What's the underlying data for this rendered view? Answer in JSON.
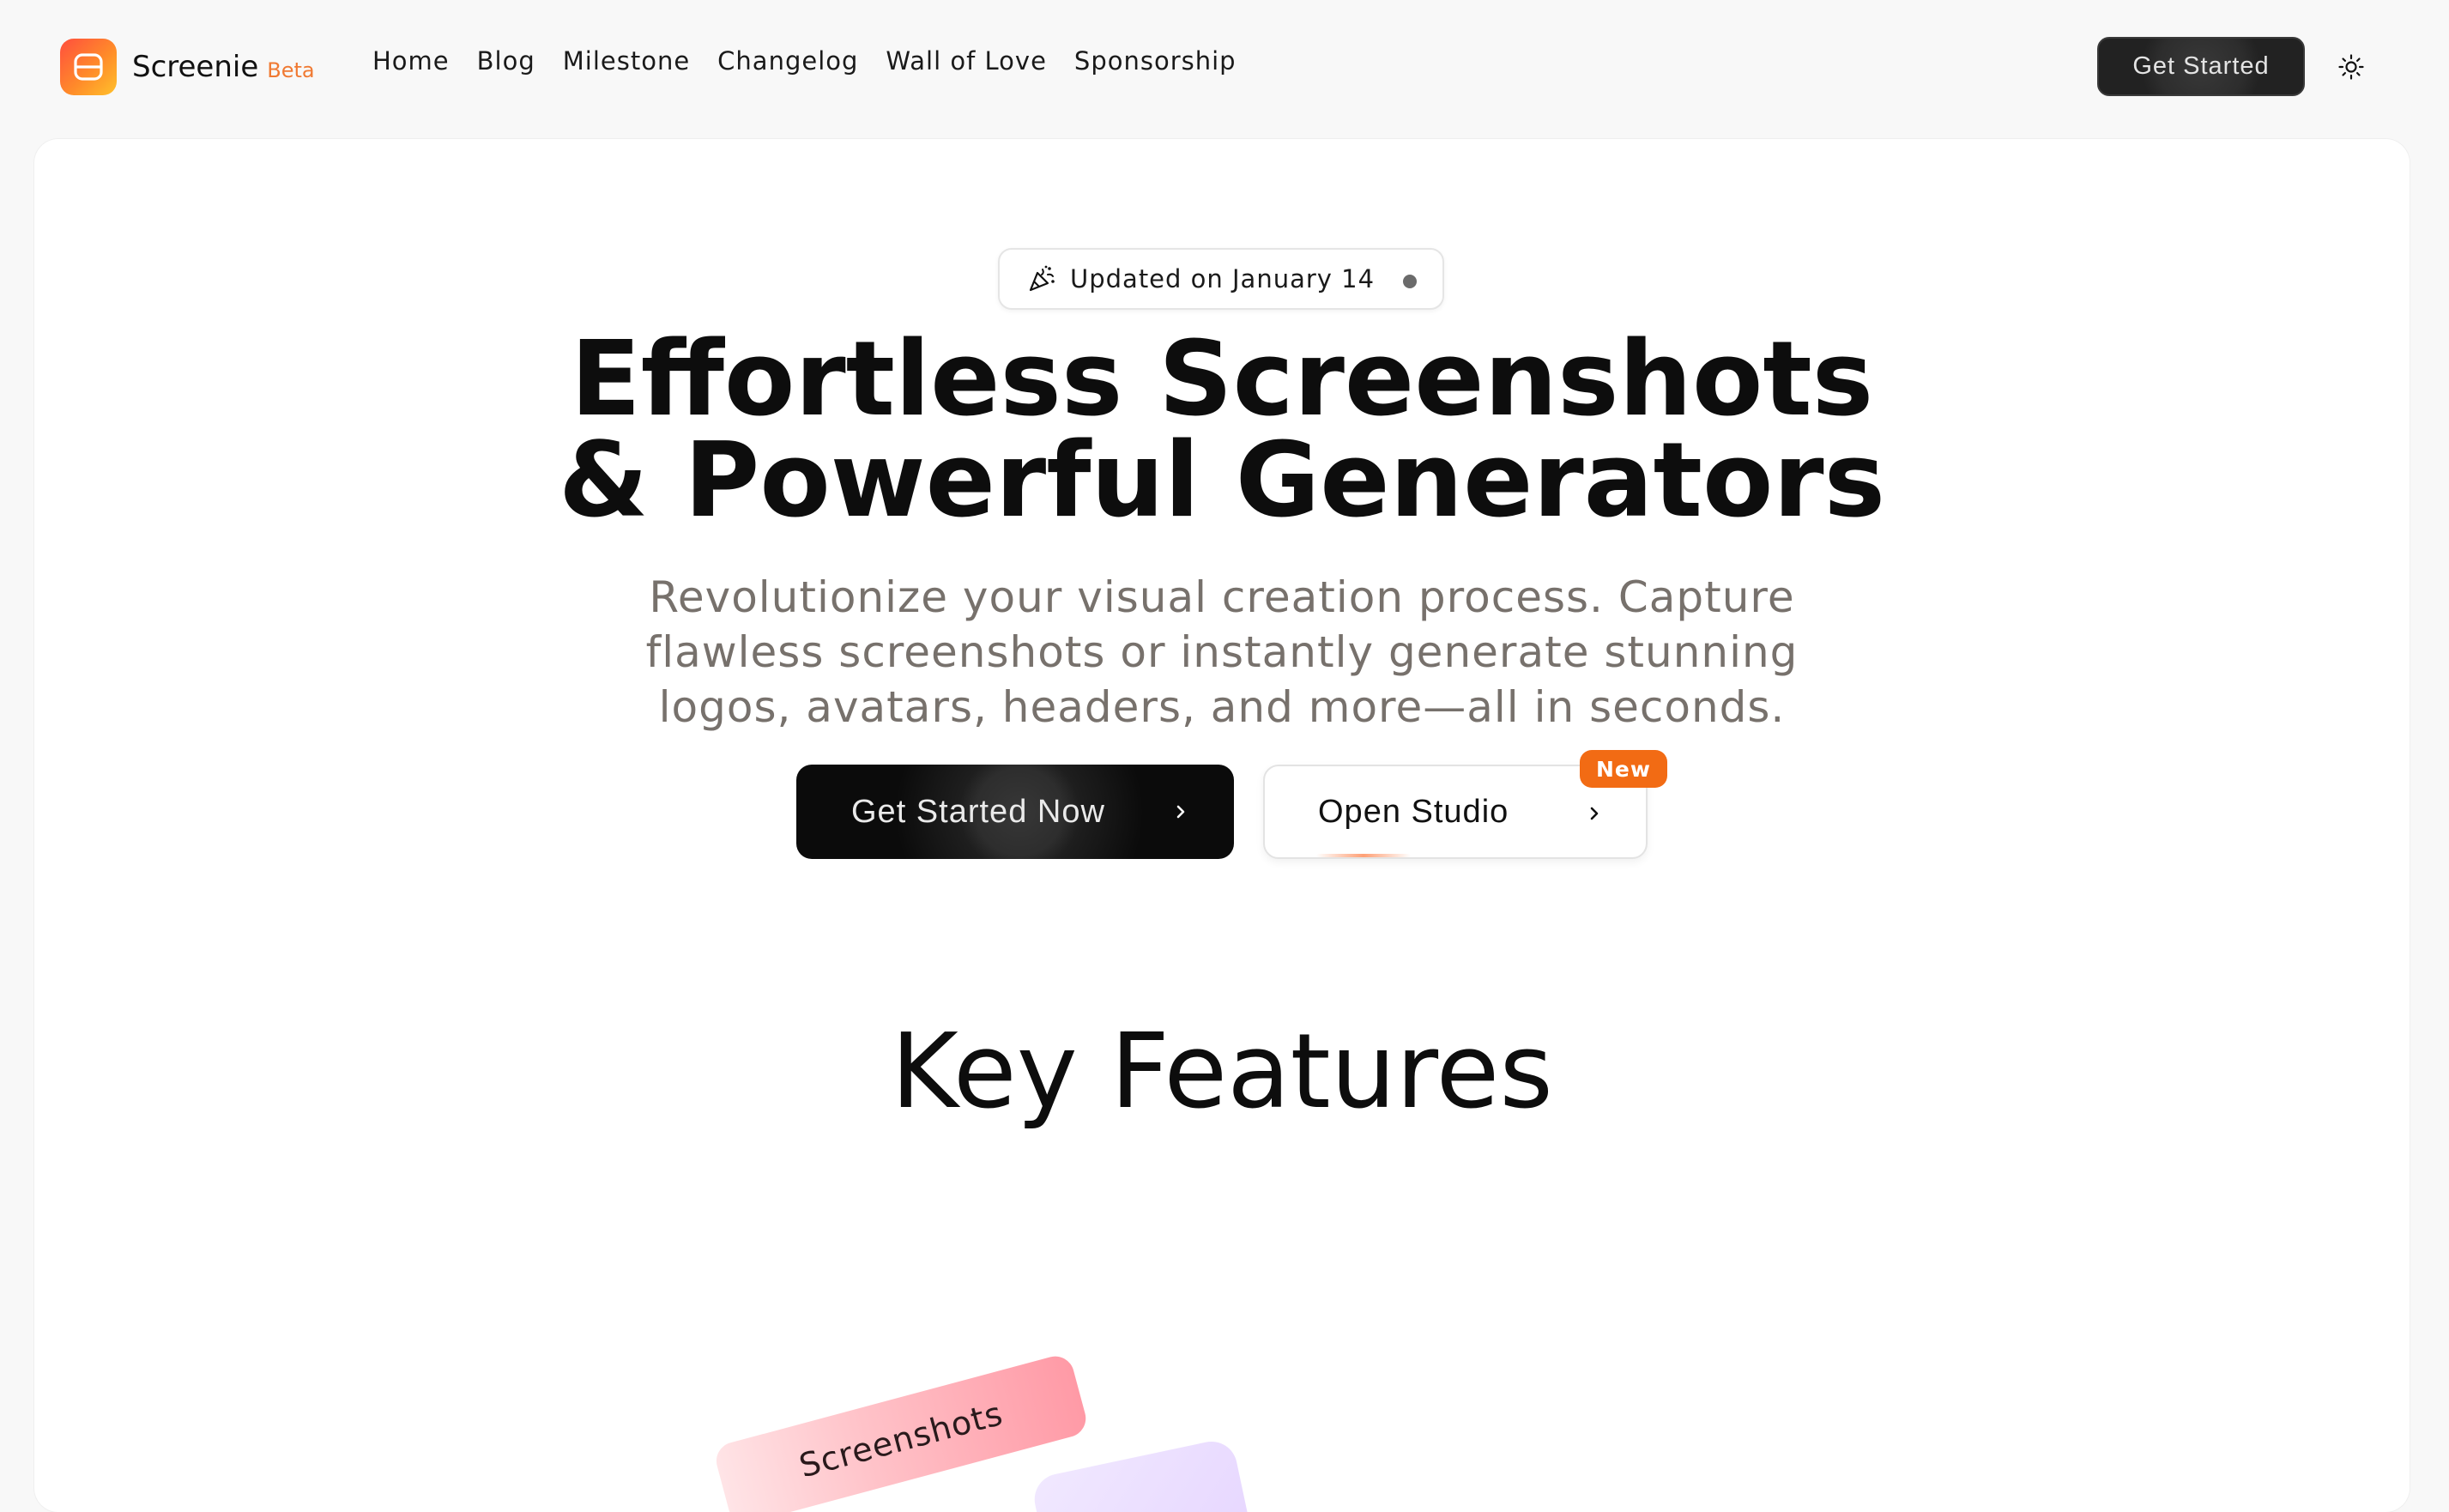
{
  "nav": {
    "brand_name": "Screenie",
    "brand_tag": "Beta",
    "links": [
      {
        "label": "Home"
      },
      {
        "label": "Blog"
      },
      {
        "label": "Milestone"
      },
      {
        "label": "Changelog"
      },
      {
        "label": "Wall of Love"
      },
      {
        "label": "Sponsorship"
      }
    ],
    "cta_label": "Get Started",
    "theme_toggle_icon": "sun-icon"
  },
  "hero": {
    "badge_text": "Updated on January 14",
    "badge_icon": "party-popper-icon",
    "headline_line1": "Effortless Screenshots",
    "headline_line2": "& Powerful Generators",
    "subheadline": "Revolutionize your visual creation process. Capture flawless screenshots or instantly generate stunning logos, avatars, headers, and more—all in seconds.",
    "primary_button_label": "Get Started Now",
    "secondary_button_label": "Open Studio",
    "new_badge_label": "New"
  },
  "features": {
    "title": "Key Features",
    "tag_label": "Screenshots"
  },
  "colors": {
    "accent_orange": "#f26b14",
    "beta_orange": "#f07a33",
    "primary_button": "#0b0b0b",
    "subtext_gray": "#77716c"
  }
}
